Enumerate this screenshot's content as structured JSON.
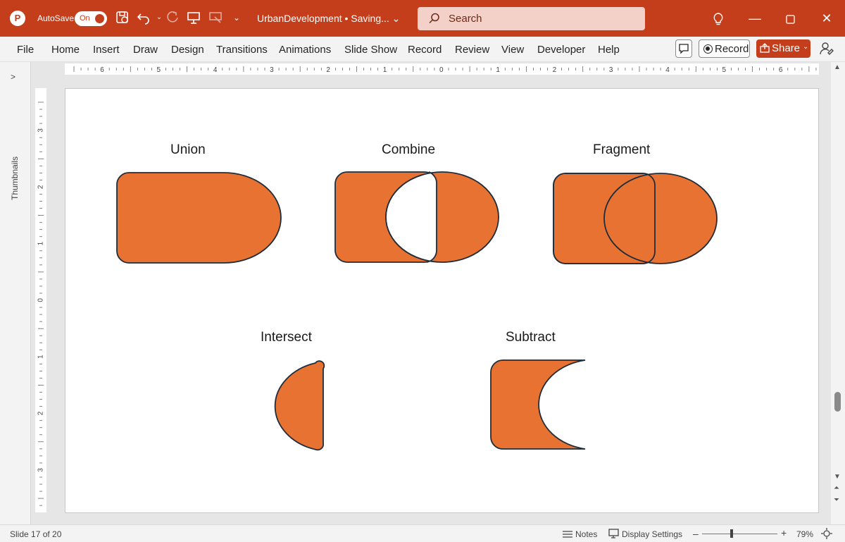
{
  "app": {
    "autosave_label": "AutoSave",
    "autosave_state": "On",
    "document_title": "UrbanDevelopment • Saving... ⌄",
    "search_placeholder": "Search",
    "accent_color": "#c43e1c"
  },
  "menu": [
    "File",
    "Home",
    "Insert",
    "Draw",
    "Design",
    "Transitions",
    "Animations",
    "Slide Show",
    "Record",
    "Review",
    "View",
    "Developer",
    "Help"
  ],
  "ribbon_right": {
    "record_label": "Record",
    "share_label": "Share"
  },
  "thumbnails_label": "Thumbnails",
  "ruler": {
    "h_labels": [
      "6",
      "5",
      "4",
      "3",
      "2",
      "1",
      "0",
      "1",
      "2",
      "3",
      "4",
      "5",
      "6"
    ],
    "v_labels": [
      "3",
      "2",
      "1",
      "0",
      "1",
      "2",
      "3"
    ]
  },
  "slide": {
    "shape_fill": "#e87232",
    "shape_stroke": "#1f2d3a",
    "titles": {
      "union": "Union",
      "combine": "Combine",
      "fragment": "Fragment",
      "intersect": "Intersect",
      "subtract": "Subtract"
    }
  },
  "status": {
    "slide_info": "Slide 17 of 20",
    "notes_label": "Notes",
    "display_settings_label": "Display Settings",
    "zoom_minus": "–",
    "zoom_plus": "+",
    "zoom_level": "79%"
  }
}
